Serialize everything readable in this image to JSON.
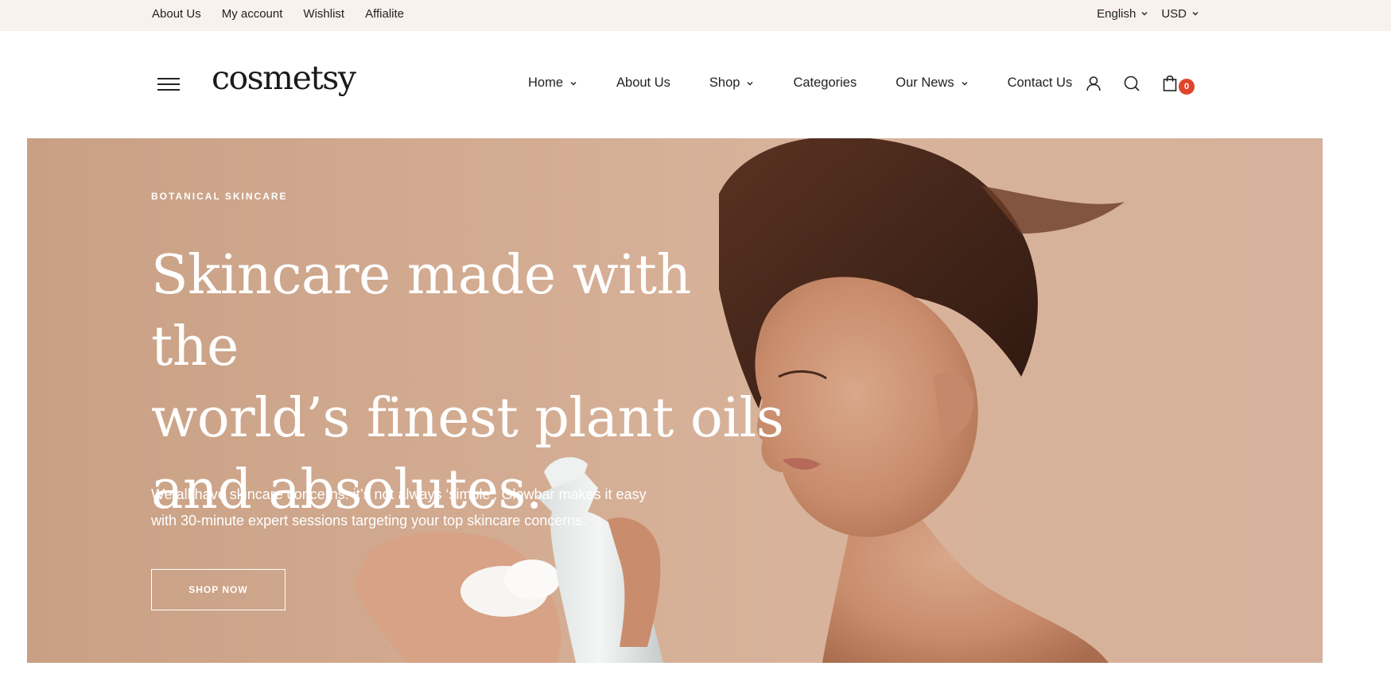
{
  "topbar": {
    "links": [
      "About Us",
      "My account",
      "Wishlist",
      "Affialite"
    ],
    "language": "English",
    "currency": "USD"
  },
  "header": {
    "logo": "cosmetsy",
    "nav": [
      {
        "label": "Home",
        "has_dropdown": true
      },
      {
        "label": "About Us",
        "has_dropdown": false
      },
      {
        "label": "Shop",
        "has_dropdown": true
      },
      {
        "label": "Categories",
        "has_dropdown": false
      },
      {
        "label": "Our News",
        "has_dropdown": true
      },
      {
        "label": "Contact Us",
        "has_dropdown": false
      }
    ],
    "icons": [
      "user-icon",
      "search-icon",
      "shopping-bag-icon"
    ],
    "cart_count": "0"
  },
  "hero": {
    "eyebrow": "BOTANICAL SKINCARE",
    "headline_lines": [
      "Skincare made with the",
      "world’s finest plant oils",
      "and absolutes."
    ],
    "subtext_lines": [
      "We all have skincare concerns: it’s not always ‘simple’. Glowbar makes it easy",
      "with 30-minute expert sessions targeting your top skincare concerns."
    ],
    "cta_label": "SHOP NOW"
  },
  "colors": {
    "topbar_bg": "#f9f1ed",
    "hero_bg": "#d2ab91",
    "badge": "#e0442b",
    "text": "#222222"
  }
}
